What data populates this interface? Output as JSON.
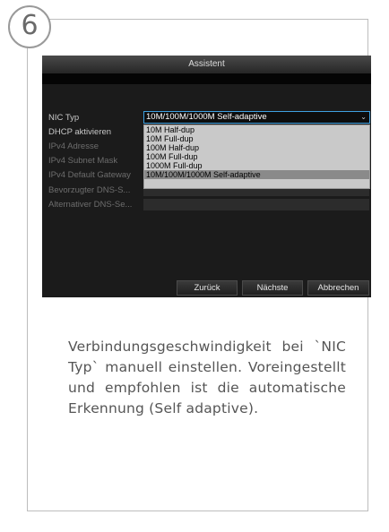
{
  "step_number": "6",
  "dialog": {
    "title": "Assistent",
    "rows": [
      {
        "label": "NIC Typ"
      },
      {
        "label": "DHCP aktivieren"
      },
      {
        "label": "IPv4 Adresse"
      },
      {
        "label": "IPv4 Subnet Mask"
      },
      {
        "label": "IPv4 Default Gateway"
      },
      {
        "label": "Bevorzugter DNS-S..."
      },
      {
        "label": "Alternativer DNS-Se..."
      }
    ],
    "nic_value": "10M/100M/1000M Self-adaptive",
    "dropdown_options": [
      "10M Half-dup",
      "10M Full-dup",
      "100M Half-dup",
      "100M Full-dup",
      "1000M Full-dup",
      "10M/100M/1000M Self-adaptive"
    ],
    "buttons": {
      "back": "Zurück",
      "next": "Nächste",
      "cancel": "Abbrechen"
    }
  },
  "caption": "Verbindungsgeschwindigkeit bei `NIC Typ` manuell einstellen. Voreingestellt und empfohlen ist die automatische Erkennung (Self adaptive)."
}
